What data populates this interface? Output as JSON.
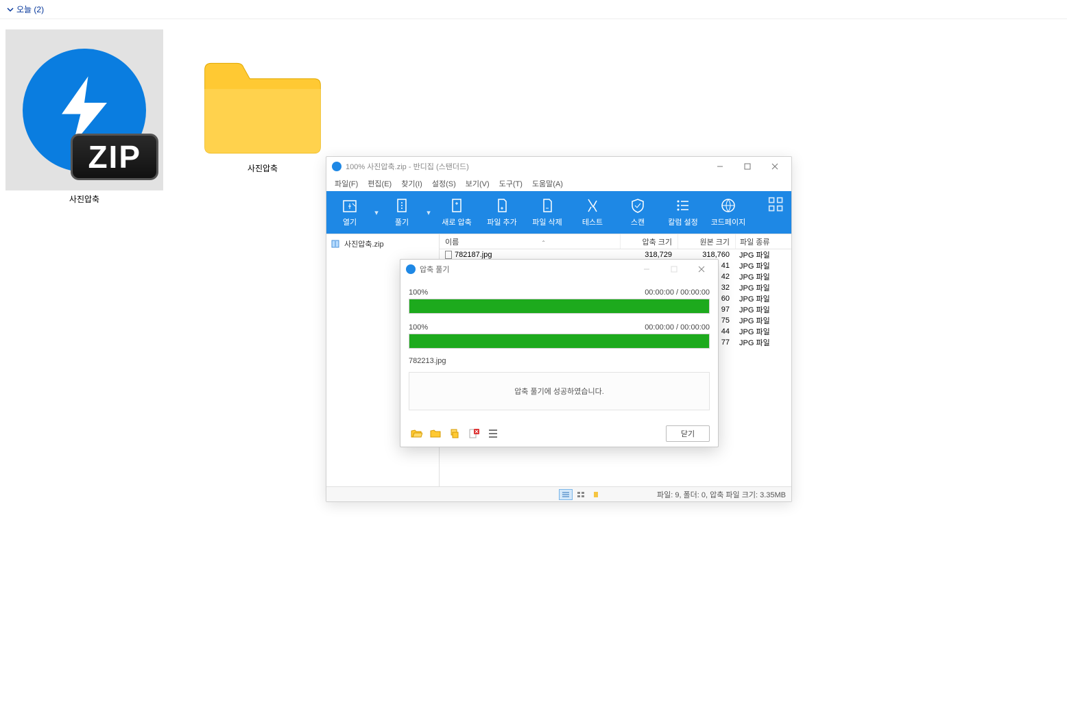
{
  "explorer": {
    "group_label": "오늘 (2)",
    "items": [
      {
        "label": "사진압축",
        "type": "zip"
      },
      {
        "label": "사진압축",
        "type": "folder"
      }
    ],
    "zip_badge_text": "ZIP"
  },
  "app": {
    "title": "100% 사진압축.zip - 반디집 (스탠더드)",
    "menus": [
      "파일(F)",
      "편집(E)",
      "찾기(I)",
      "설정(S)",
      "보기(V)",
      "도구(T)",
      "도움말(A)"
    ],
    "tools": [
      {
        "name": "open",
        "label": "열기",
        "split": true
      },
      {
        "name": "extract",
        "label": "풀기",
        "split": true
      },
      {
        "name": "new-archive",
        "label": "새로 압축",
        "split": false
      },
      {
        "name": "add-file",
        "label": "파일 추가",
        "split": false
      },
      {
        "name": "delete-file",
        "label": "파일 삭제",
        "split": false
      },
      {
        "name": "test",
        "label": "테스트",
        "split": false
      },
      {
        "name": "scan",
        "label": "스캔",
        "split": false
      },
      {
        "name": "column-settings",
        "label": "칼럼 설정",
        "split": false
      },
      {
        "name": "codepage",
        "label": "코드페이지",
        "split": false
      }
    ],
    "tree_root": "사진압축.zip",
    "columns": {
      "name": "이름",
      "compressed": "압축 크기",
      "original": "원본 크기",
      "type": "파일 종류"
    },
    "rows": [
      {
        "name": "782187.jpg",
        "compressed": "318,729",
        "original": "318,760",
        "type": "JPG 파일"
      },
      {
        "name": "",
        "compressed": "",
        "original": "41",
        "type": "JPG 파일"
      },
      {
        "name": "",
        "compressed": "",
        "original": "42",
        "type": "JPG 파일"
      },
      {
        "name": "",
        "compressed": "",
        "original": "32",
        "type": "JPG 파일"
      },
      {
        "name": "",
        "compressed": "",
        "original": "60",
        "type": "JPG 파일"
      },
      {
        "name": "",
        "compressed": "",
        "original": "97",
        "type": "JPG 파일"
      },
      {
        "name": "",
        "compressed": "",
        "original": "75",
        "type": "JPG 파일"
      },
      {
        "name": "",
        "compressed": "",
        "original": "44",
        "type": "JPG 파일"
      },
      {
        "name": "",
        "compressed": "",
        "original": "77",
        "type": "JPG 파일"
      }
    ],
    "status": "파일: 9, 폴더: 0, 압축 파일 크기: 3.35MB"
  },
  "dialog": {
    "title": "압축 풀기",
    "progress1_pct": "100%",
    "progress1_time": "00:00:00 / 00:00:00",
    "progress2_pct": "100%",
    "progress2_time": "00:00:00 / 00:00:00",
    "current_file": "782213.jpg",
    "result_text": "압축 풀기에 성공하였습니다.",
    "close_label": "닫기"
  }
}
